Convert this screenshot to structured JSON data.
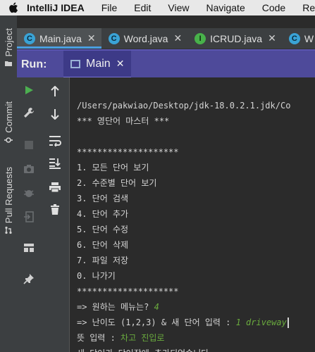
{
  "menubar": {
    "app_name": "IntelliJ IDEA",
    "items": [
      "File",
      "Edit",
      "View",
      "Navigate",
      "Code",
      "Refac"
    ]
  },
  "sidebar": {
    "project_label": "Project",
    "commit_label": "Commit",
    "pull_requests_label": "Pull Requests"
  },
  "editor_tabs": [
    {
      "label": "Main.java",
      "icon": "class-icon",
      "icon_text": "C",
      "active": true
    },
    {
      "label": "Word.java",
      "icon": "class-icon",
      "icon_text": "C",
      "active": false
    },
    {
      "label": "ICRUD.java",
      "icon": "interface-icon",
      "icon_text": "I",
      "active": false
    },
    {
      "label": "W",
      "icon": "class-icon",
      "icon_text": "C",
      "active": false
    }
  ],
  "run_panel": {
    "label": "Run:",
    "tab_label": "Main"
  },
  "console": {
    "path_line": "/Users/pakwiao/Desktop/jdk-18.0.2.1.jdk/Co",
    "title_line": "*** 영단어 마스터 ***",
    "separator": "********************",
    "menu": [
      "1. 모든 단어 보기",
      "2. 수준별 단어 보기",
      "3. 단어 검색",
      "4. 단어 추가",
      "5. 단어 수정",
      "6. 단어 삭제",
      "7. 파일 저장",
      "0. 나가기"
    ],
    "prompt_menu": "=> 원하는 메뉴는? ",
    "input_menu": "4",
    "prompt_level": "=> 난이도 (1,2,3) & 새 단어 입력 : ",
    "input_level": "1 driveway",
    "prompt_meaning": "뜻 입력 : ",
    "input_meaning": "차고 진입로",
    "result": "새 단어가 단어장에 추가되었습니다."
  },
  "colors": {
    "menubar_bg": "#e8e8e8",
    "run_header_bg": "#4e4a9a",
    "console_bg": "#2b2b2b",
    "input_text": "#6aab3e",
    "run_icon": "#4caf50",
    "class_icon": "#3aa3d6",
    "interface_icon": "#48b14a"
  }
}
